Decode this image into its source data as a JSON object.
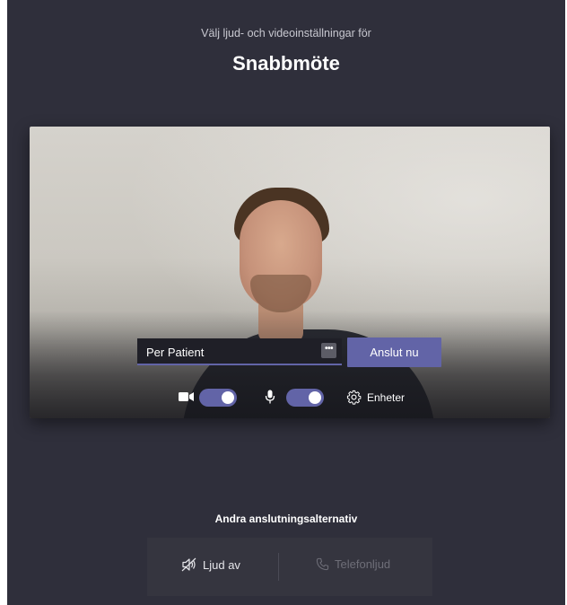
{
  "header": {
    "subtitle": "Välj ljud- och videoinställningar för",
    "title": "Snabbmöte"
  },
  "preview": {
    "name_value": "Per Patient",
    "more_label": "•••",
    "join_label": "Anslut nu"
  },
  "controls": {
    "camera_icon": "camera-icon",
    "camera_on": true,
    "mic_icon": "microphone-icon",
    "mic_on": true,
    "devices_icon": "gear-icon",
    "devices_label": "Enheter"
  },
  "alternatives": {
    "title": "Andra anslutningsalternativ",
    "audio_off_label": "Ljud av",
    "audio_off_icon": "speaker-off-icon",
    "phone_label": "Telefonljud",
    "phone_icon": "phone-icon"
  },
  "colors": {
    "background": "#2f2f3b",
    "accent": "#6264a7",
    "input_bg": "#1f1f27"
  }
}
